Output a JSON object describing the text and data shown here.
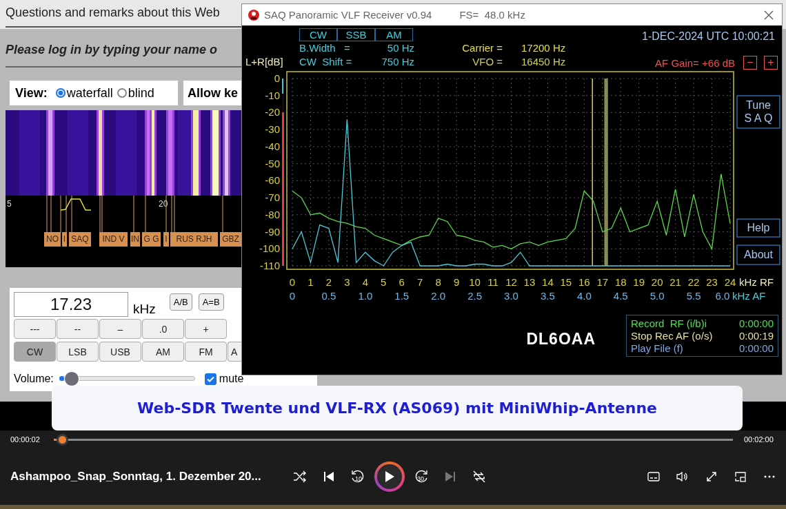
{
  "page": {
    "heading": "Questions and remarks about this Web",
    "login_prompt": "Please log in by typing your name o",
    "view": {
      "label": "View:",
      "options": [
        {
          "label": "waterfall",
          "selected": true
        },
        {
          "label": "blind",
          "selected": false
        }
      ]
    },
    "allow_label": "Allow ke",
    "waterfall": {
      "scale_labels": [
        "5",
        "20"
      ],
      "stations": [
        {
          "label": "NO"
        },
        {
          "label": "I"
        },
        {
          "label": "SAQ"
        },
        {
          "label": "IND V"
        },
        {
          "label": "IN"
        },
        {
          "label": "G G"
        },
        {
          "label": "I"
        },
        {
          "label": "RUS RJH"
        },
        {
          "label": "GBZ"
        }
      ]
    },
    "frequency": {
      "value": "17.23",
      "unit": "kHz"
    },
    "vfo_buttons": [
      "A/B",
      "A=B"
    ],
    "step_buttons": [
      "---",
      "--",
      "–",
      ".0",
      "+"
    ],
    "mode_buttons": [
      {
        "label": "CW",
        "selected": true
      },
      {
        "label": "LSB",
        "selected": false
      },
      {
        "label": "USB",
        "selected": false
      },
      {
        "label": "AM",
        "selected": false
      },
      {
        "label": "FM",
        "selected": false
      },
      {
        "label": "A",
        "selected": false
      }
    ],
    "volume": {
      "label": "Volume:",
      "level": 0.04
    },
    "mute": {
      "label": "mute",
      "checked": true
    }
  },
  "receiver": {
    "title": "SAQ Panoramic VLF Receiver v0.94",
    "sample_rate": "FS=  48.0 kHz",
    "modes": [
      "CW",
      "SSB",
      "AM"
    ],
    "bandwidth": {
      "label": "B.Width   =",
      "value": "50 Hz"
    },
    "cw_shift": {
      "label": "CW  Shift =",
      "value": "750 Hz"
    },
    "carrier": {
      "label": "Carrier =",
      "value": "17200 Hz"
    },
    "vfo": {
      "label": "VFO =",
      "value": "16450 Hz"
    },
    "datetime": "1-DEC-2024 UTC 10:00:21",
    "af_gain": "AF Gain= +66 dB",
    "gain_buttons": [
      "−",
      "+"
    ],
    "chart_data": {
      "type": "line",
      "ylabel": "L+R[dB]",
      "xlabel": "kHz RF",
      "x": [
        0,
        0.5,
        1,
        1.5,
        2,
        2.5,
        3,
        3.5,
        4,
        4.5,
        5,
        5.5,
        6,
        6.5,
        7,
        7.5,
        8,
        8.5,
        9,
        9.5,
        10,
        10.5,
        11,
        11.5,
        12,
        12.5,
        13,
        13.5,
        14,
        14.5,
        15,
        15.5,
        16,
        16.5,
        17,
        17.5,
        18,
        18.5,
        19,
        19.5,
        20,
        20.5,
        21,
        21.5,
        22,
        22.5,
        23,
        23.5,
        24
      ],
      "series": [
        {
          "color": "#5ad84a",
          "values": [
            -66,
            -70,
            -80,
            -79,
            -82,
            -84,
            -85,
            -87,
            -88,
            -92,
            -94,
            -96,
            -98,
            -95,
            -93,
            -92,
            -82,
            -84,
            -92,
            -93,
            -95,
            -96,
            -99,
            -98,
            -100,
            -97,
            -96,
            -98,
            -96,
            -95,
            -94,
            -88,
            -66,
            -72,
            -90,
            -88,
            -76,
            -90,
            -88,
            -86,
            -72,
            -92,
            -65,
            -93,
            -68,
            -90,
            -100,
            -56,
            -85
          ]
        },
        {
          "color": "#4cc8d8",
          "values": [
            -100,
            -90,
            -108,
            -86,
            -88,
            -108,
            -24,
            -108,
            -102,
            -107,
            -110,
            -102,
            -98,
            -96,
            -110,
            -110,
            -110,
            -109,
            -110,
            -110,
            -109,
            -109,
            -110,
            -110,
            -108,
            -102,
            -110,
            -110,
            -110,
            -110,
            -110,
            -110,
            -110,
            -110,
            -110,
            -110,
            -110,
            -110,
            -110,
            -110,
            -110,
            -110,
            -110,
            -110,
            -110,
            -110,
            -110,
            -110,
            -110
          ]
        }
      ],
      "xlim": [
        0,
        24
      ],
      "ylim": [
        -110,
        0
      ],
      "xticks": [
        0,
        1,
        2,
        3,
        4,
        5,
        6,
        7,
        8,
        9,
        10,
        11,
        12,
        13,
        14,
        15,
        16,
        17,
        18,
        19,
        20,
        21,
        22,
        23,
        24
      ],
      "yticks": [
        0,
        -10,
        -20,
        -30,
        -40,
        -50,
        -60,
        -70,
        -80,
        -90,
        -100,
        -110
      ],
      "grid": true,
      "ref_lines": [
        {
          "axis": "x",
          "value": 16.45
        }
      ],
      "bands": [
        {
          "axis": "x",
          "from": 17.1,
          "to": 17.3
        }
      ]
    },
    "af_axis": {
      "labels": [
        "0",
        "0.5",
        "1.0",
        "1.5",
        "2.0",
        "2.5",
        "3.0",
        "3.5",
        "4.0",
        "4.5",
        "5.0",
        "5.5",
        "6.0"
      ],
      "unit": "kHz AF"
    },
    "rf_meter": {
      "level": 0.82
    },
    "side_buttons": [
      {
        "lines": [
          "Tune",
          "S A Q"
        ]
      },
      {
        "lines": [
          "Help"
        ]
      },
      {
        "lines": [
          "About"
        ]
      }
    ],
    "callsign": "DL6OAA",
    "recorder": [
      {
        "label": "Record  RF (i/b)i",
        "time": "0:00:00",
        "color": "#50e050"
      },
      {
        "label": "Stop Rec AF (o/s)",
        "time": "0:00:19",
        "color": "#e8e0a0"
      },
      {
        "label": "Play File (f)",
        "time": "0:00:00",
        "color": "#80a8e0"
      }
    ]
  },
  "caption": "Web-SDR Twente und VLF-RX (AS069) mit MiniWhip-Antenne",
  "player": {
    "elapsed": "00:00:02",
    "duration": "00:02:00",
    "progress": {
      "level": 0.012
    },
    "title": "Ashampoo_Snap_Sonntag, 1. Dezember 20...",
    "controls": [
      {
        "kind": "shuffle",
        "disabled": false
      },
      {
        "kind": "previous",
        "disabled": false
      },
      {
        "kind": "rewind",
        "label": "10",
        "disabled": false
      },
      {
        "kind": "play",
        "disabled": false
      },
      {
        "kind": "forward",
        "label": "30",
        "disabled": false
      },
      {
        "kind": "next",
        "disabled": true
      },
      {
        "kind": "repeat",
        "disabled": false
      }
    ],
    "right_controls": [
      {
        "kind": "captions"
      },
      {
        "kind": "volume"
      },
      {
        "kind": "fullscreen"
      },
      {
        "kind": "miniplayer"
      },
      {
        "kind": "more"
      }
    ]
  }
}
